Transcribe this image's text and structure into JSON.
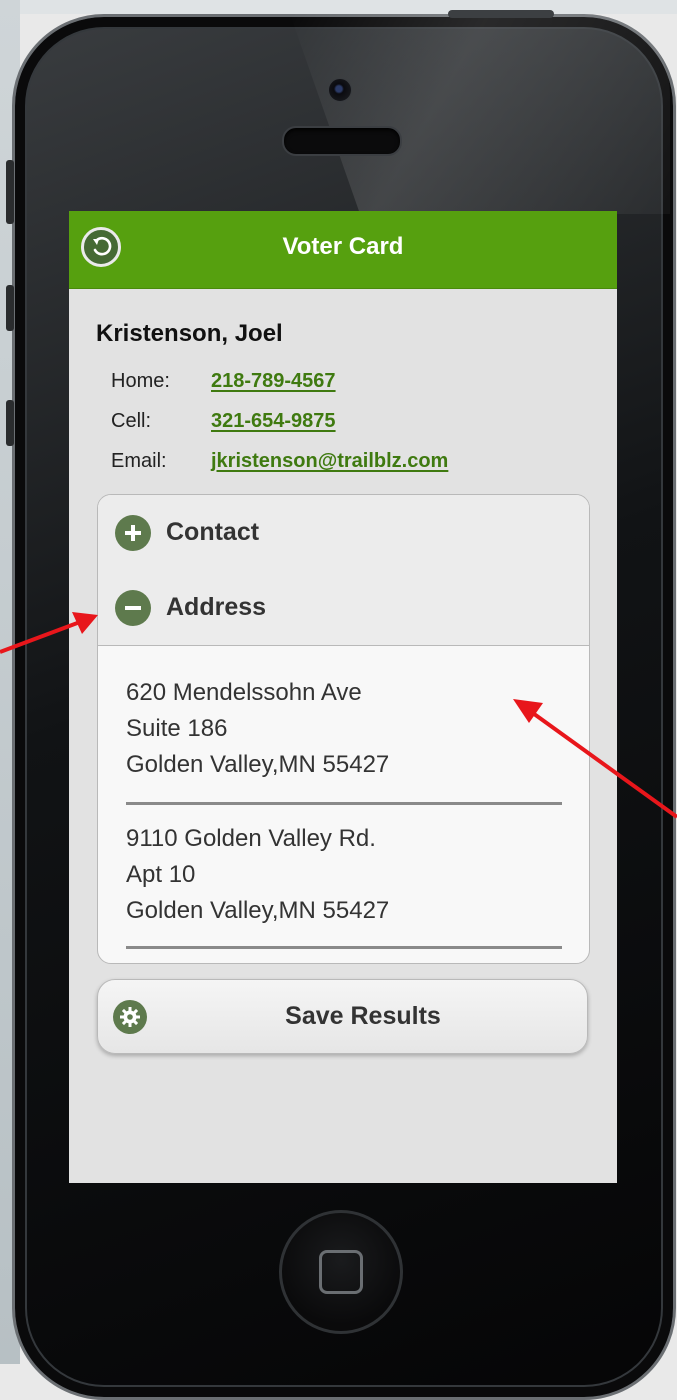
{
  "header": {
    "title": "Voter Card",
    "back_icon": "back-arrow-circle-icon"
  },
  "voter": {
    "name": "Kristenson, Joel",
    "contacts": [
      {
        "label": "Home:",
        "value": "218-789-4567"
      },
      {
        "label": "Cell:",
        "value": "321-654-9875"
      },
      {
        "label": "Email:",
        "value": "jkristenson@trailblz.com"
      }
    ]
  },
  "accordion": {
    "contact": {
      "label": "Contact",
      "icon": "plus-circle-icon",
      "expanded": false
    },
    "address": {
      "label": "Address",
      "icon": "minus-circle-icon",
      "expanded": true
    }
  },
  "addresses": [
    {
      "line1": "620 Mendelssohn Ave",
      "line2": "Suite 186",
      "line3": "Golden Valley,MN 55427"
    },
    {
      "line1": "9110 Golden Valley Rd.",
      "line2": "Apt 10",
      "line3": "Golden Valley,MN 55427"
    }
  ],
  "actions": {
    "save_label": "Save Results",
    "save_icon": "gear-icon"
  },
  "colors": {
    "header": "#56a00f",
    "link": "#3f7a10",
    "icon": "#5e7a4d",
    "arrow": "#e8161b"
  },
  "stray_text": ")"
}
